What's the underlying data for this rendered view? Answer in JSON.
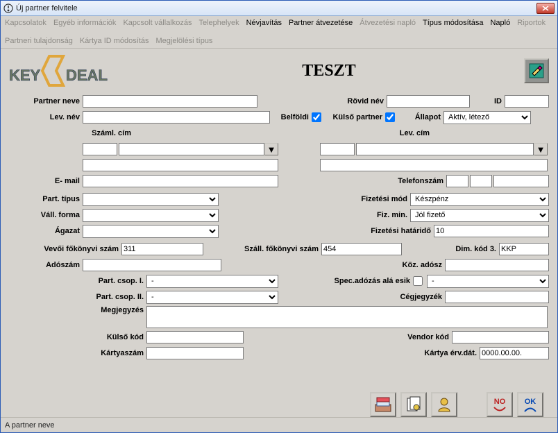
{
  "window_title": "Új partner felvitele",
  "menu": {
    "items": [
      {
        "label": "Kapcsolatok",
        "disabled": true
      },
      {
        "label": "Egyéb információk",
        "disabled": true
      },
      {
        "label": "Kapcsolt vállalkozás",
        "disabled": true
      },
      {
        "label": "Telephelyek",
        "disabled": true
      },
      {
        "label": "Névjavítás",
        "disabled": false
      },
      {
        "label": "Partner átvezetése",
        "disabled": false
      },
      {
        "label": "Átvezetési napló",
        "disabled": true
      },
      {
        "label": "Típus módosítása",
        "disabled": false
      },
      {
        "label": "Napló",
        "disabled": false
      },
      {
        "label": "Riportok",
        "disabled": true
      },
      {
        "label": "Partneri tulajdonság",
        "disabled": true
      },
      {
        "label": "Kártya ID módosítás",
        "disabled": true
      },
      {
        "label": "Megjelölési típus",
        "disabled": true
      }
    ]
  },
  "main_title": "TESZT",
  "labels": {
    "partner_neve": "Partner neve",
    "rovid_nev": "Rövid név",
    "id": "ID",
    "lev_nev": "Lev. név",
    "belfoldi": "Belföldi",
    "kulso_partner": "Külső partner",
    "allapot": "Állapot",
    "szaml_cim": "Száml. cím",
    "lev_cim": "Lev. cím",
    "email": "E- mail",
    "telefonszam": "Telefonszám",
    "part_tipus": "Part. típus",
    "fizetesi_mod": "Fizetési mód",
    "vall_forma": "Váll. forma",
    "fiz_min": "Fiz. min.",
    "agazat": "Ágazat",
    "fizetesi_hatarido": "Fizetési határidő",
    "vevoi_fokonyvi": "Vevői főkönyvi szám",
    "szall_fokonyvi": "Száll. főkönyvi szám",
    "dim_kod3": "Dim. kód 3.",
    "adoszam": "Adószám",
    "koz_adosz": "Köz. adósz",
    "part_csop1": "Part. csop. I.",
    "spec_adozas": "Spec.adózás alá esik",
    "part_csop2": "Part. csop. II.",
    "cegjegyzek": "Cégjegyzék",
    "megjegyzes": "Megjegyzés",
    "kulso_kod": "Külső kód",
    "vendor_kod": "Vendor kód",
    "kartyaszam": "Kártyaszám",
    "kartya_erv": "Kártya érv.dát.",
    "no": "NO",
    "ok": "OK"
  },
  "values": {
    "partner_neve": "",
    "rovid_nev": "",
    "id": "",
    "lev_nev": "",
    "belfoldi": true,
    "kulso_partner": true,
    "allapot": "Aktív, létező",
    "szaml_cim_zip": "",
    "szaml_cim_city": "",
    "lev_cim_zip": "",
    "lev_cim_city": "",
    "email": "",
    "tel1": "",
    "tel2": "",
    "tel3": "",
    "part_tipus": "",
    "fizetesi_mod": "Készpénz",
    "vall_forma": "",
    "fiz_min": "Jól fizető",
    "agazat": "",
    "fizetesi_hatarido": "10",
    "vevoi_fokonyvi": "311",
    "szall_fokonyvi": "454",
    "dim_kod3": "KKP",
    "adoszam": "",
    "koz_adosz": "",
    "part_csop1": "-",
    "spec_adozas": false,
    "spec_adozas_sel": "-",
    "part_csop2": "-",
    "cegjegyzek": "",
    "megjegyzes": "",
    "kulso_kod": "",
    "vendor_kod": "",
    "kartyaszam": "",
    "kartya_erv": "0000.00.00."
  },
  "status_text": "A partner neve"
}
